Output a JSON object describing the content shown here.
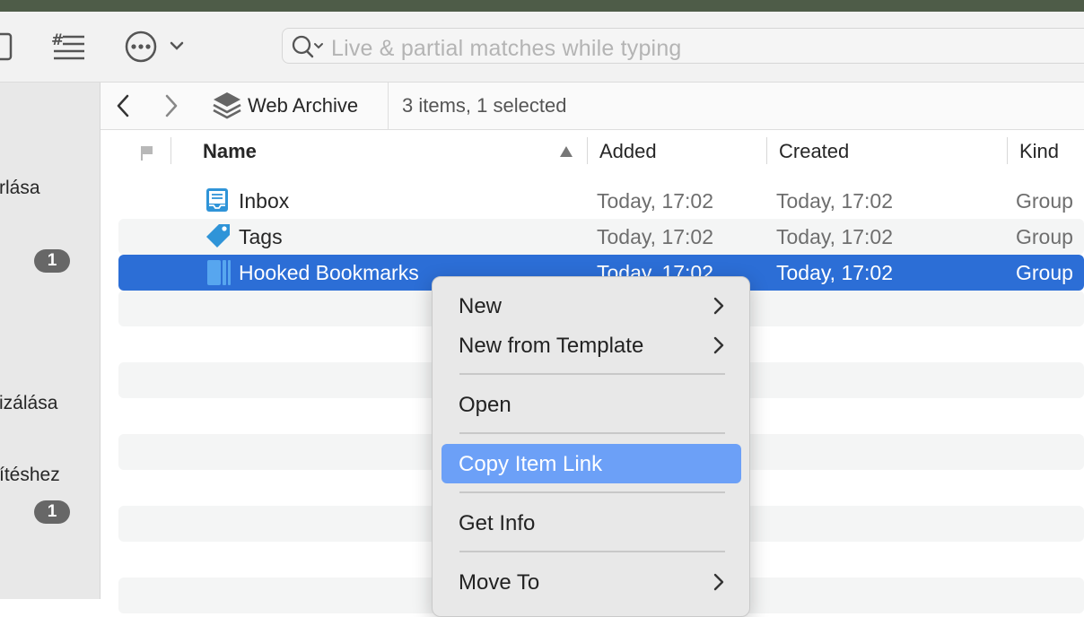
{
  "toolbar": {
    "search_placeholder": "Live & partial matches while typing"
  },
  "sidebar": {
    "items": [
      {
        "label": "rlása"
      },
      {
        "badge": "1"
      },
      {
        "label": "izálása"
      },
      {
        "label": "ítéshez"
      },
      {
        "badge": "1"
      }
    ]
  },
  "pathbar": {
    "location": "Web Archive",
    "status": "3 items, 1 selected"
  },
  "columns": {
    "name": "Name",
    "added": "Added",
    "created": "Created",
    "kind": "Kind"
  },
  "rows": [
    {
      "name": "Inbox",
      "added": "Today, 17:02",
      "created": "Today, 17:02",
      "kind": "Group",
      "icon": "inbox-icon"
    },
    {
      "name": "Tags",
      "added": "Today, 17:02",
      "created": "Today, 17:02",
      "kind": "Group",
      "icon": "tag-icon"
    },
    {
      "name": "Hooked Bookmarks",
      "added": "Today, 17:02",
      "created": "Today, 17:02",
      "kind": "Group",
      "icon": "group-icon",
      "selected": true
    }
  ],
  "context_menu": {
    "items": [
      {
        "label": "New",
        "submenu": true
      },
      {
        "label": "New from Template",
        "submenu": true
      },
      {
        "label": "Open"
      },
      {
        "label": "Copy Item Link",
        "highlighted": true
      },
      {
        "label": "Get Info"
      },
      {
        "label": "Move To",
        "submenu": true
      }
    ]
  },
  "colors": {
    "selection": "#2c6ed6",
    "menu_highlight": "#6ca0f7",
    "title_strip": "#4e5c48"
  }
}
